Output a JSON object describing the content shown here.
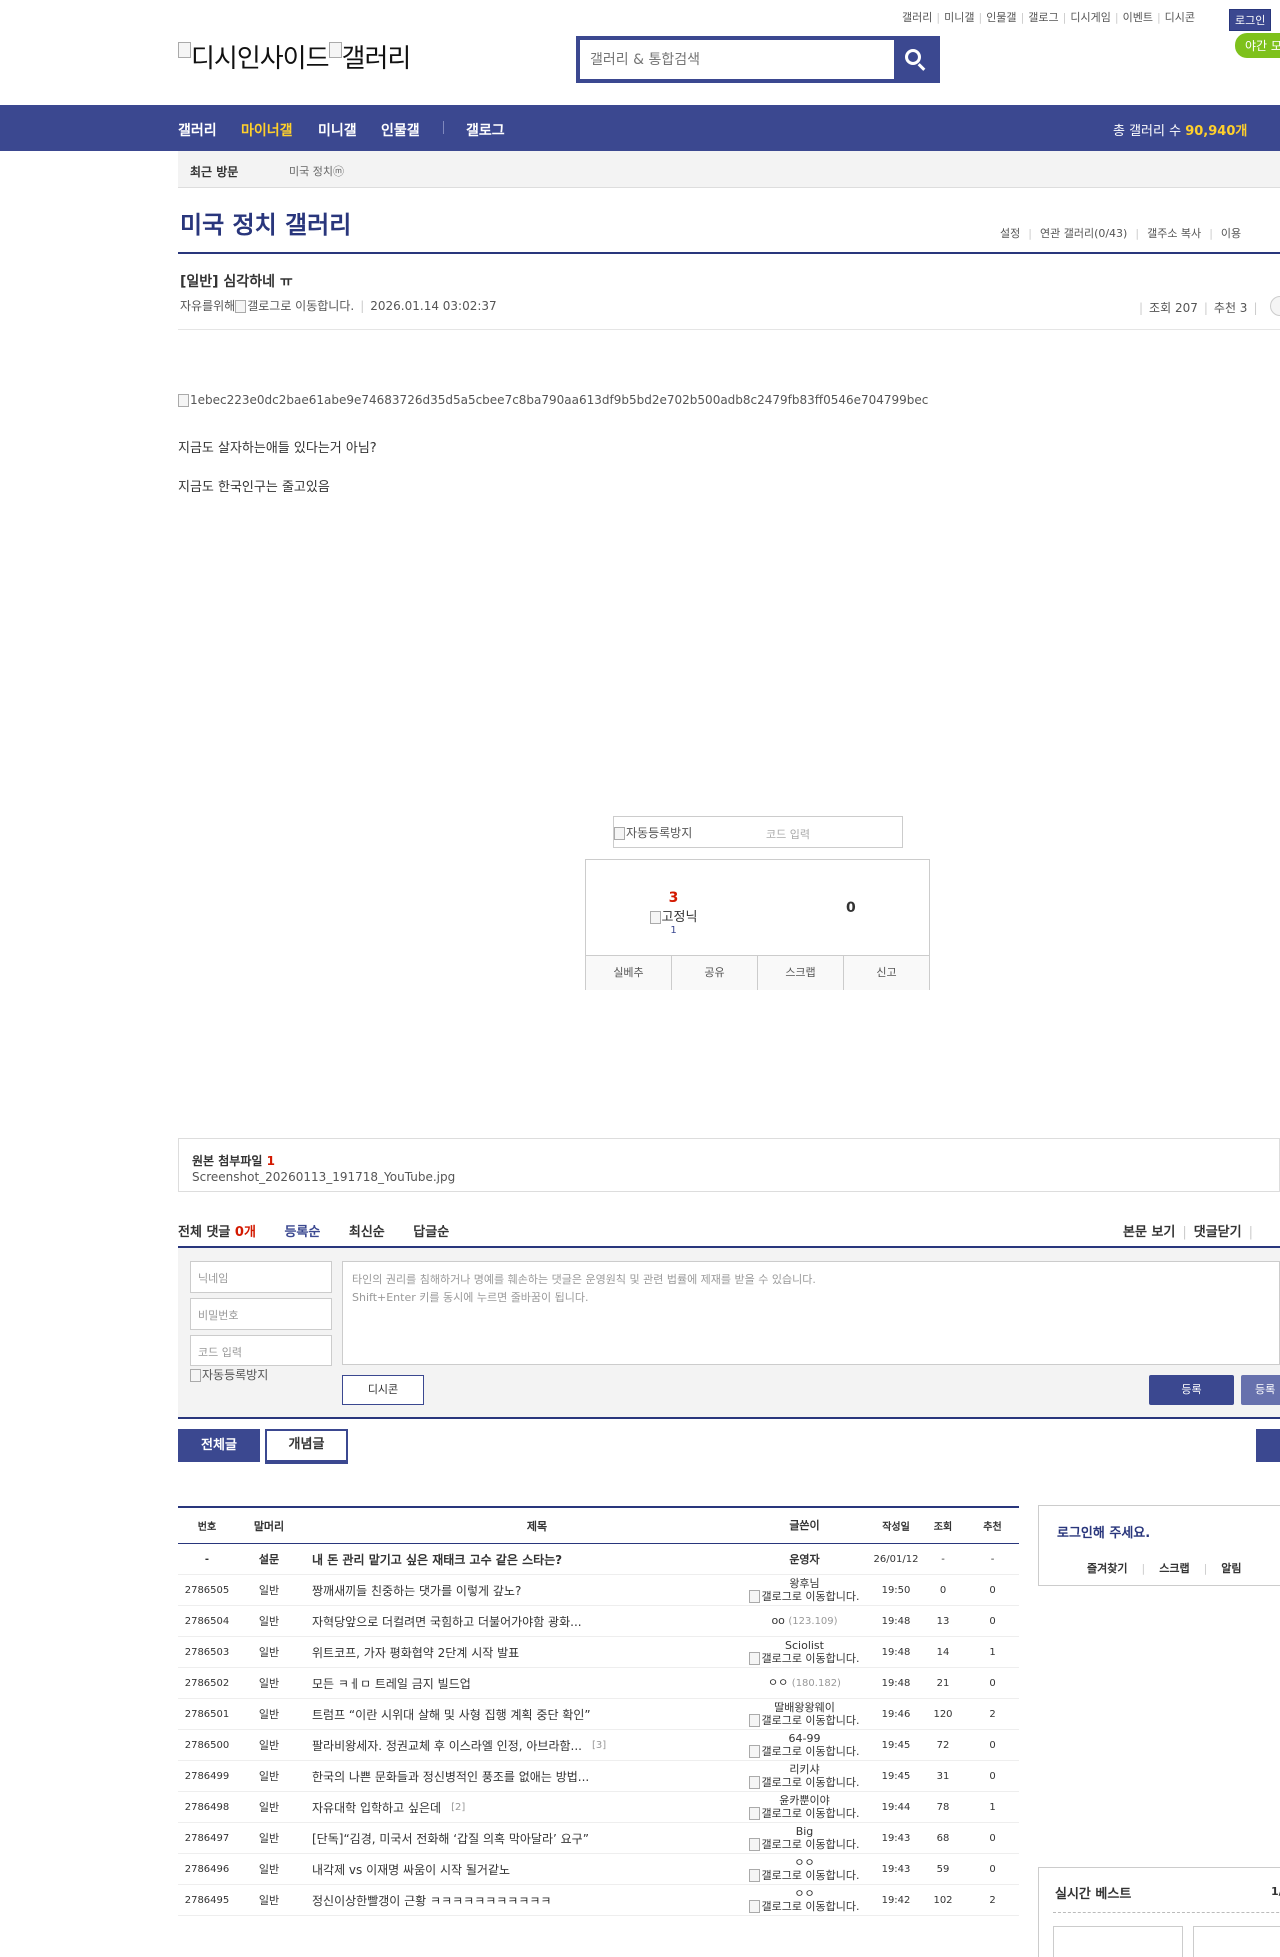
{
  "top_links": [
    "갤러리",
    "미니갤",
    "인물갤",
    "갤로그",
    "디시게임",
    "이벤트",
    "디시콘"
  ],
  "login_button": "로그인",
  "night_mode": "야간 모",
  "logo": {
    "left": "디시인사이드",
    "right": "갤러리"
  },
  "search": {
    "placeholder": "갤러리 & 통합검색"
  },
  "gnb": {
    "menus": [
      "갤러리",
      "마이너갤",
      "미니갤",
      "인물갤",
      "갤로그"
    ],
    "active": "마이너갤",
    "total_label": "총 갤러리 수 ",
    "total_value": "90,940개"
  },
  "visit": {
    "label": "최근 방문",
    "item": "미국 정치",
    "item_badge": "ⓜ"
  },
  "gallery": {
    "title": "미국 정치 갤러리",
    "links": [
      "설정",
      "연관 갤러리(0/43)",
      "갤주소 복사",
      "이용"
    ]
  },
  "post": {
    "title": "[일반] 심각하네 ㅠ",
    "author": "자유를위해",
    "author_gallog_alt": "갤로그로 이동합니다.",
    "date": "2026.01.14 03:02:37",
    "views_label": "조회 207",
    "recommend_label": "추천 3",
    "image_alt": "1ebec223e0dc2bae61abe9e74683726d35d5a5cbee7c8ba790aa613df9b5bd2e702b500adb8c2479fb83ff0546e704799bec",
    "lines": [
      "지금도 살자하는애들 있다는거 아님?",
      "지금도 한국인구는 줄고있음"
    ]
  },
  "recommend": {
    "captcha_alt": "자동등록방지",
    "captcha_placeholder": "코드 입력",
    "up_count": "3",
    "up_label": "고정닉",
    "up_sub": "1",
    "down_count": "0",
    "buttons": [
      "실베추",
      "공유",
      "스크랩",
      "신고"
    ]
  },
  "attachment": {
    "title": "원본 첨부파일 ",
    "count": "1",
    "file": "Screenshot_20260113_191718_YouTube.jpg"
  },
  "comments": {
    "total_label": "전체 댓글 ",
    "total_count": "0개",
    "sorts": [
      "등록순",
      "최신순",
      "답글순"
    ],
    "active_sort": "등록순",
    "right_links": [
      "본문 보기",
      "댓글닫기"
    ],
    "form": {
      "nickname_placeholder": "닉네임",
      "password_placeholder": "비밀번호",
      "code_placeholder": "코드 입력",
      "captcha_alt": "자동등록방지",
      "textarea_line1": "타인의 권리를 침해하거나 명예를 훼손하는 댓글은 운영원칙 및 관련 법률에 제재를 받을 수 있습니다.",
      "textarea_line2": "Shift+Enter 키를 동시에 누르면 줄바꿈이 됩니다.",
      "dccon": "디시콘",
      "register": "등록",
      "register2": "등록"
    }
  },
  "list_tabs": {
    "all": "전체글",
    "best": "개념글"
  },
  "list": {
    "headers": {
      "num": "번호",
      "head": "말머리",
      "title": "제목",
      "writer": "글쓴이",
      "date": "작성일",
      "views": "조회",
      "rec": "추천"
    },
    "notice": {
      "num": "-",
      "head": "설문",
      "title": "내 돈 관리 맡기고 싶은 재태크 고수 같은 스타는?",
      "writer": "운영자",
      "date": "26/01/12",
      "views": "-",
      "rec": "-"
    },
    "rows": [
      {
        "num": "2786505",
        "head": "일반",
        "title": "짱깨새끼들 친중하는 댓가를 이렇게 갚노?",
        "cc": "",
        "writer": "왕후님",
        "ip": "",
        "gallog": "갤로그로 이동합니다.",
        "date": "19:50",
        "views": "0",
        "rec": "0"
      },
      {
        "num": "2786504",
        "head": "일반",
        "title": "자혁당앞으로 더컬려면 국힘하고 더불어가야함 광화...",
        "cc": "",
        "writer": "oo",
        "ip": "(123.109)",
        "gallog": "",
        "date": "19:48",
        "views": "13",
        "rec": "0"
      },
      {
        "num": "2786503",
        "head": "일반",
        "title": "위트코프, 가자 평화협약 2단계 시작 발표",
        "cc": "",
        "writer": "Sciolist",
        "ip": "",
        "gallog": "갤로그로 이동합니다.",
        "date": "19:48",
        "views": "14",
        "rec": "1"
      },
      {
        "num": "2786502",
        "head": "일반",
        "title": "모든 ㅋㅔㅁ 트레일 금지 빌드업",
        "cc": "",
        "writer": "ㅇㅇ",
        "ip": "(180.182)",
        "gallog": "",
        "date": "19:48",
        "views": "21",
        "rec": "0"
      },
      {
        "num": "2786501",
        "head": "일반",
        "title": "트럼프 “이란 시위대 살해 및 사형 집행 계획 중단 확인”",
        "cc": "",
        "writer": "딸배왕왕웨이",
        "ip": "",
        "gallog": "갤로그로 이동합니다.",
        "date": "19:46",
        "views": "120",
        "rec": "2"
      },
      {
        "num": "2786500",
        "head": "일반",
        "title": "팔라비왕세자. 정권교체 후 이스라엘 인정, 아브라함...",
        "cc": "[3]",
        "writer": "64-99",
        "ip": "",
        "gallog": "갤로그로 이동합니다.",
        "date": "19:45",
        "views": "72",
        "rec": "0"
      },
      {
        "num": "2786499",
        "head": "일반",
        "title": "한국의 나쁜 문화들과 정신병적인 풍조를 없애는 방법...",
        "cc": "",
        "writer": "리키샤",
        "ip": "",
        "gallog": "갤로그로 이동합니다.",
        "date": "19:45",
        "views": "31",
        "rec": "0"
      },
      {
        "num": "2786498",
        "head": "일반",
        "title": "자유대학 입학하고 싶은데",
        "cc": "[2]",
        "writer": "윤카뿐이야",
        "ip": "",
        "gallog": "갤로그로 이동합니다.",
        "date": "19:44",
        "views": "78",
        "rec": "1"
      },
      {
        "num": "2786497",
        "head": "일반",
        "title": "[단독]“김경, 미국서 전화해 ‘갑질 의혹 막아달라’ 요구”",
        "cc": "",
        "writer": "Big",
        "ip": "",
        "gallog": "갤로그로 이동합니다.",
        "date": "19:43",
        "views": "68",
        "rec": "0"
      },
      {
        "num": "2786496",
        "head": "일반",
        "title": "내각제 vs 이재명 싸움이 시작 될거같노",
        "cc": "",
        "writer": "ㅇㅇ",
        "ip": "",
        "gallog": "갤로그로 이동합니다.",
        "date": "19:43",
        "views": "59",
        "rec": "0"
      },
      {
        "num": "2786495",
        "head": "일반",
        "title": "정신이상한빨갱이 근황 ㅋㅋㅋㅋㅋㅋㅋㅋㅋㅋㅋ",
        "cc": "",
        "writer": "ㅇㅇ",
        "ip": "",
        "gallog": "갤로그로 이동합니다.",
        "date": "19:42",
        "views": "102",
        "rec": "2"
      }
    ]
  },
  "sidebar": {
    "login_title": "로그인해 주세요.",
    "login_links": [
      "즐겨찾기",
      "스크랩",
      "알림"
    ],
    "best_title": "실시간 베스트",
    "best_page": "1/"
  }
}
